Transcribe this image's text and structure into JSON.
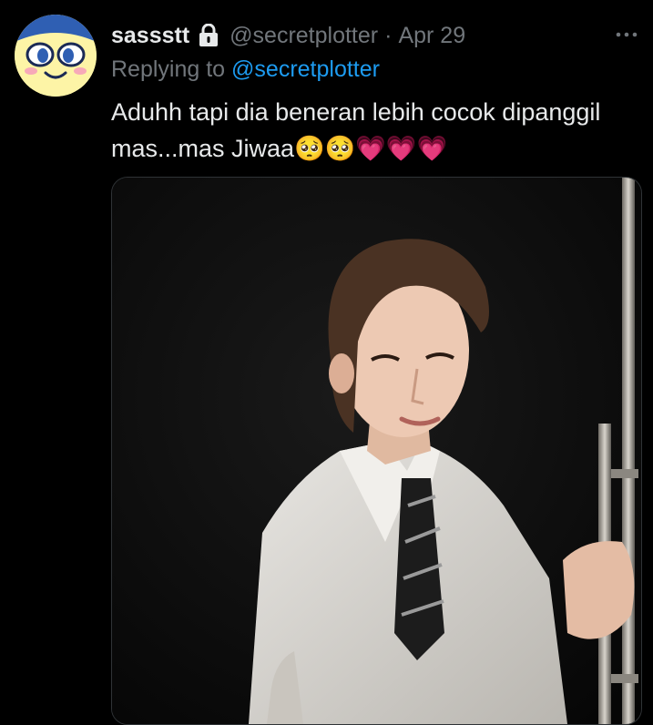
{
  "tweet": {
    "display_name": "sassstt",
    "handle": "@secretplotter",
    "separator": "·",
    "date": "Apr 29",
    "reply_prefix": "Replying to ",
    "reply_handle": "@secretplotter",
    "text": "Aduhh tapi dia beneran lebih cocok dipanggil\nmas...mas Jiwaa🥺🥺💗💗💗",
    "more_label": "···"
  },
  "icons": {
    "avatar": "cartoon-face-avatar",
    "lock": "lock-icon",
    "more": "more-horizontal-icon"
  },
  "colors": {
    "background": "#000000",
    "primary_text": "#e7e9ea",
    "secondary_text": "#71767b",
    "link": "#1d9bf0"
  }
}
